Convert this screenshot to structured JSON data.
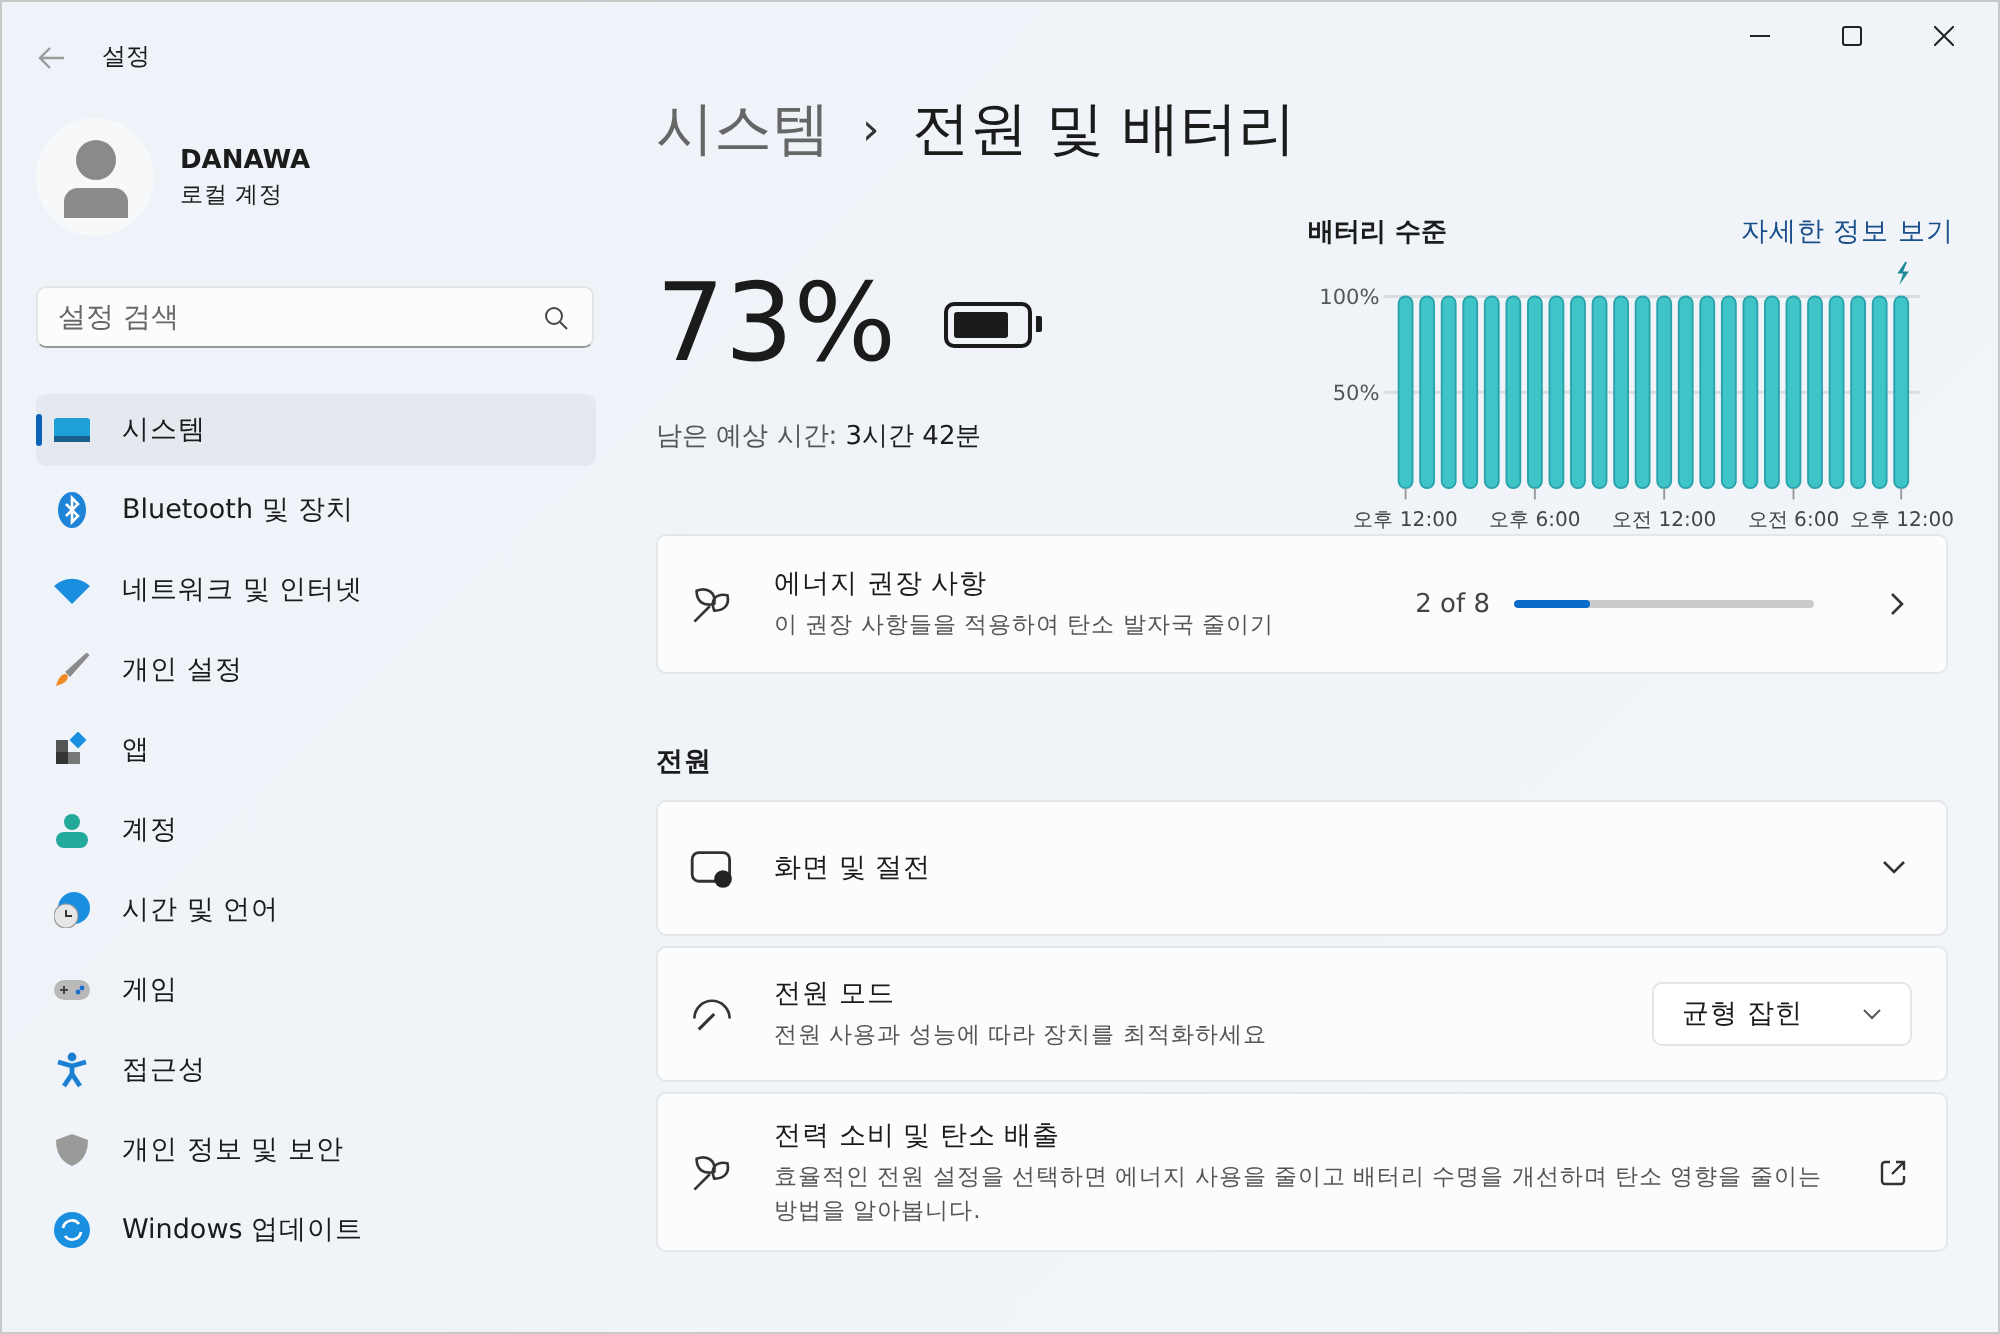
{
  "window": {
    "title": "설정"
  },
  "account": {
    "name": "DANAWA",
    "type": "로컬 계정"
  },
  "search": {
    "placeholder": "설정 검색"
  },
  "sidebar": {
    "items": [
      {
        "label": "시스템",
        "selected": true
      },
      {
        "label": "Bluetooth 및 장치",
        "selected": false
      },
      {
        "label": "네트워크 및 인터넷",
        "selected": false
      },
      {
        "label": "개인 설정",
        "selected": false
      },
      {
        "label": "앱",
        "selected": false
      },
      {
        "label": "계정",
        "selected": false
      },
      {
        "label": "시간 및 언어",
        "selected": false
      },
      {
        "label": "게임",
        "selected": false
      },
      {
        "label": "접근성",
        "selected": false
      },
      {
        "label": "개인 정보 및 보안",
        "selected": false
      },
      {
        "label": "Windows 업데이트",
        "selected": false
      }
    ]
  },
  "breadcrumb": {
    "parent": "시스템",
    "separator": "›",
    "current": "전원 및 배터리"
  },
  "battery": {
    "percent": "73%",
    "remaining": "남은 예상 시간: **3시간 42분**"
  },
  "battery_chart": {
    "title": "배터리 수준",
    "link": "자세한 정보 보기",
    "charging": true,
    "chart_data": {
      "type": "bar",
      "categories": [
        "오후 12:00",
        null,
        null,
        null,
        null,
        null,
        "오후 6:00",
        null,
        null,
        null,
        null,
        null,
        "오전 12:00",
        null,
        null,
        null,
        null,
        null,
        "오전 6:00",
        null,
        null,
        null,
        null,
        "오후 12:00"
      ],
      "series": [
        {
          "color": "#3fc4c8",
          "values": [
            100,
            100,
            100,
            100,
            100,
            100,
            100,
            100,
            100,
            100,
            100,
            100,
            100,
            100,
            100,
            100,
            100,
            100,
            100,
            100,
            100,
            100,
            100,
            100
          ]
        }
      ],
      "ylim": [
        0,
        100
      ],
      "yticks": [
        {
          "value": 50,
          "label": "50%"
        },
        {
          "value": 100,
          "label": "100%"
        }
      ]
    }
  },
  "energy": {
    "title": "에너지 권장 사항",
    "subtitle": "이 권장 사항들을 적용하여 탄소 발자국 줄이기",
    "count": "2 of 8",
    "level": 0.25
  },
  "power_section": {
    "heading": "전원",
    "rows": [
      {
        "kind": "expander",
        "title": "화면 및 절전"
      },
      {
        "kind": "dropdown",
        "title": "전원 모드",
        "subtitle": "전원 사용과 성능에 따라 장치를 최적화하세요",
        "value": "균형 잡힌"
      },
      {
        "kind": "link",
        "title": "전력 소비 및 탄소 배출",
        "subtitle": "효율적인 전원 설정을 선택하면 에너지 사용을 줄이고 배터리 수명을 개선하며 탄소 영향을 줄이는 방법을 알아봅니다."
      }
    ]
  }
}
